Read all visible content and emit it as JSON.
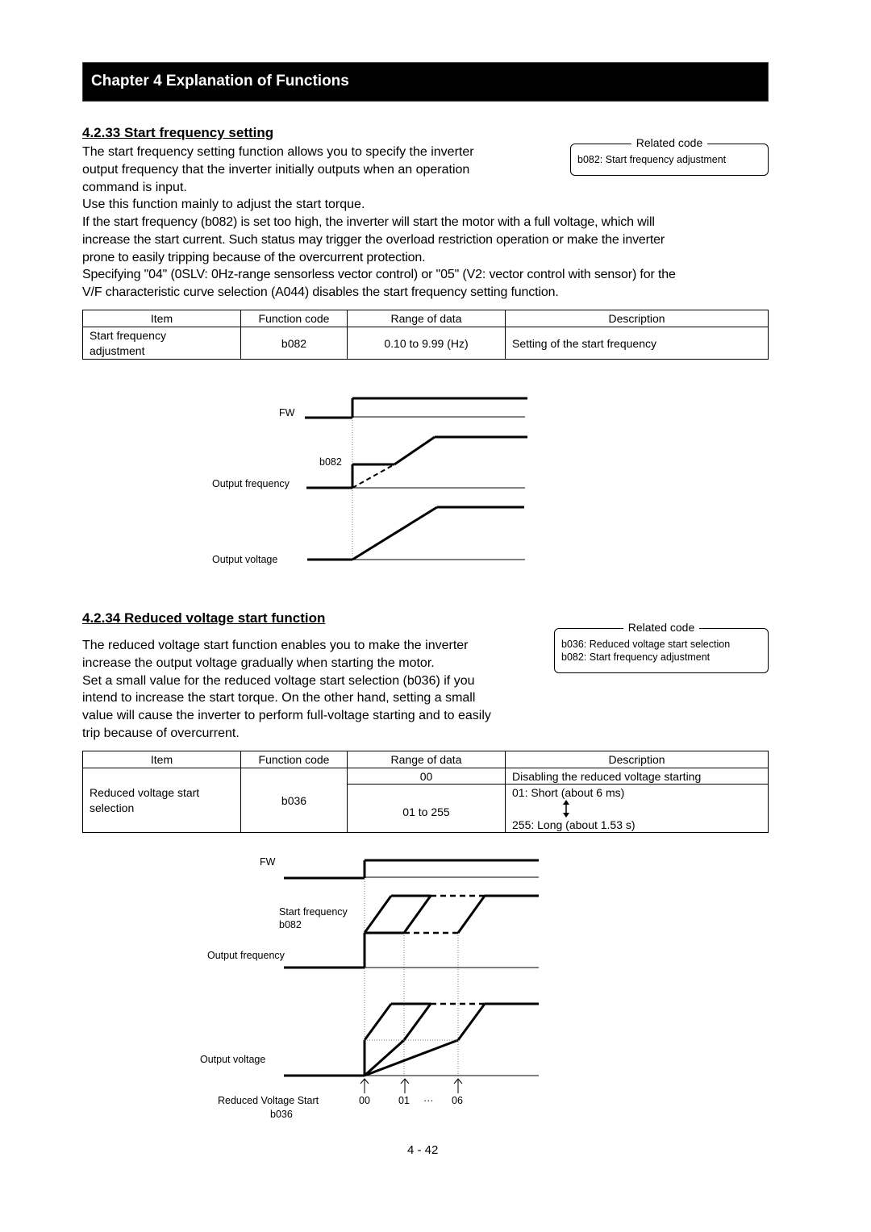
{
  "chapter": {
    "title": "Chapter 4 Explanation of Functions"
  },
  "section1": {
    "title": "4.2.33 Start frequency setting",
    "paragraphs_top": [
      "The start frequency setting function allows you to specify the inverter",
      "output frequency that the inverter initially outputs when an operation",
      "command is input.",
      "Use this function mainly to adjust the start torque."
    ],
    "paragraphs_full": [
      "If the start frequency (b082) is set too high, the inverter will start the motor with a full voltage, which will",
      "increase the start current. Such status may trigger the overload restriction operation or make the inverter",
      "prone to easily tripping because of the overcurrent protection.",
      "Specifying \"04\" (0SLV: 0Hz-range sensorless vector control) or \"05\" (V2: vector control with sensor) for the",
      "V/F characteristic curve selection (A044) disables the start frequency setting function."
    ],
    "related": {
      "label": "Related code",
      "lines": [
        "b082: Start frequency adjustment"
      ]
    },
    "table": {
      "headers": [
        "Item",
        "Function code",
        "Range of data",
        "Description"
      ],
      "rows": [
        {
          "item": [
            "Start frequency",
            "adjustment"
          ],
          "code": "b082",
          "range": "0.10 to 9.99 (Hz)",
          "description": "Setting of the start frequency"
        }
      ]
    },
    "diagram": {
      "labels": {
        "fw": "FW",
        "b082": "b082",
        "output_frequency": "Output frequency",
        "output_voltage": "Output voltage"
      }
    }
  },
  "section2": {
    "title": "4.2.34 Reduced voltage start function",
    "paragraphs": [
      "The reduced voltage start function enables you to make the inverter",
      "increase the output voltage gradually when starting the motor.",
      "Set a small value for the reduced voltage start selection (b036) if you",
      "intend to increase the start torque. On the other hand, setting a small",
      "value will cause the inverter to perform full-voltage starting and to easily",
      "trip because of overcurrent."
    ],
    "related": {
      "label": "Related code",
      "lines": [
        "b036: Reduced voltage start selection",
        "b082: Start frequency adjustment"
      ]
    },
    "table": {
      "headers": [
        "Item",
        "Function code",
        "Range of data",
        "Description"
      ],
      "item": [
        "Reduced voltage start",
        "selection"
      ],
      "code": "b036",
      "rows": [
        {
          "range": "00",
          "description": "Disabling the reduced voltage starting"
        },
        {
          "range": "01 to 255",
          "description_top": "01: Short (about 6 ms)",
          "description_bottom": "255: Long (about 1.53 s)"
        }
      ]
    },
    "diagram": {
      "labels": {
        "fw": "FW",
        "start_frequency": "Start frequency",
        "b082": "b082",
        "output_frequency": "Output frequency",
        "output_voltage": "Output voltage",
        "rvs": "Reduced Voltage Start",
        "b036": "b036"
      },
      "markers": [
        "00",
        "01",
        "···",
        "06"
      ]
    }
  },
  "footer": {
    "page_number": "4 - 42"
  }
}
